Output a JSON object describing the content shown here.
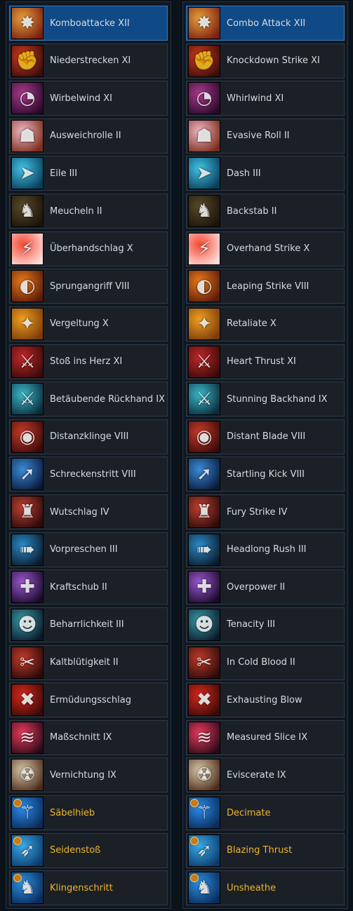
{
  "left_items": [
    {
      "label": "Komboattacke XII",
      "icon": "combo-attack-icon",
      "selected": true,
      "gold": false
    },
    {
      "label": "Niederstrecken XI",
      "icon": "knockdown-strike-icon",
      "selected": false,
      "gold": false
    },
    {
      "label": "Wirbelwind XI",
      "icon": "whirlwind-icon",
      "selected": false,
      "gold": false
    },
    {
      "label": "Ausweichrolle II",
      "icon": "evasive-roll-icon",
      "selected": false,
      "gold": false
    },
    {
      "label": "Eile III",
      "icon": "dash-icon",
      "selected": false,
      "gold": false
    },
    {
      "label": "Meucheln II",
      "icon": "backstab-icon",
      "selected": false,
      "gold": false
    },
    {
      "label": "Überhandschlag X",
      "icon": "overhand-strike-icon",
      "selected": false,
      "gold": false
    },
    {
      "label": "Sprungangriff VIII",
      "icon": "leaping-strike-icon",
      "selected": false,
      "gold": false
    },
    {
      "label": "Vergeltung X",
      "icon": "retaliate-icon",
      "selected": false,
      "gold": false
    },
    {
      "label": "Stoß ins Herz XI",
      "icon": "heart-thrust-icon",
      "selected": false,
      "gold": false
    },
    {
      "label": "Betäubende Rückhand IX",
      "icon": "stunning-backhand-icon",
      "selected": false,
      "gold": false
    },
    {
      "label": "Distanzklinge VIII",
      "icon": "distant-blade-icon",
      "selected": false,
      "gold": false
    },
    {
      "label": "Schreckenstritt VIII",
      "icon": "startling-kick-icon",
      "selected": false,
      "gold": false
    },
    {
      "label": "Wutschlag IV",
      "icon": "fury-strike-icon",
      "selected": false,
      "gold": false
    },
    {
      "label": "Vorpreschen III",
      "icon": "headlong-rush-icon",
      "selected": false,
      "gold": false
    },
    {
      "label": "Kraftschub II",
      "icon": "overpower-icon",
      "selected": false,
      "gold": false
    },
    {
      "label": "Beharrlichkeit III",
      "icon": "tenacity-icon",
      "selected": false,
      "gold": false
    },
    {
      "label": "Kaltblütigkeit II",
      "icon": "in-cold-blood-icon",
      "selected": false,
      "gold": false
    },
    {
      "label": "Ermüdungsschlag",
      "icon": "exhausting-blow-icon",
      "selected": false,
      "gold": false
    },
    {
      "label": "Maßschnitt IX",
      "icon": "measured-slice-icon",
      "selected": false,
      "gold": false
    },
    {
      "label": "Vernichtung IX",
      "icon": "eviscerate-icon",
      "selected": false,
      "gold": false
    },
    {
      "label": "Säbelhieb",
      "icon": "decimate-icon",
      "selected": false,
      "gold": true
    },
    {
      "label": "Seidenstoß",
      "icon": "blazing-thrust-icon",
      "selected": false,
      "gold": true
    },
    {
      "label": "Klingenschritt",
      "icon": "unsheathe-icon",
      "selected": false,
      "gold": true
    }
  ],
  "right_items": [
    {
      "label": "Combo Attack XII",
      "icon": "combo-attack-icon",
      "selected": true,
      "gold": false
    },
    {
      "label": "Knockdown Strike XI",
      "icon": "knockdown-strike-icon",
      "selected": false,
      "gold": false
    },
    {
      "label": "Whirlwind XI",
      "icon": "whirlwind-icon",
      "selected": false,
      "gold": false
    },
    {
      "label": "Evasive Roll II",
      "icon": "evasive-roll-icon",
      "selected": false,
      "gold": false
    },
    {
      "label": "Dash III",
      "icon": "dash-icon",
      "selected": false,
      "gold": false
    },
    {
      "label": "Backstab II",
      "icon": "backstab-icon",
      "selected": false,
      "gold": false
    },
    {
      "label": "Overhand Strike X",
      "icon": "overhand-strike-icon",
      "selected": false,
      "gold": false
    },
    {
      "label": "Leaping Strike VIII",
      "icon": "leaping-strike-icon",
      "selected": false,
      "gold": false
    },
    {
      "label": "Retaliate X",
      "icon": "retaliate-icon",
      "selected": false,
      "gold": false
    },
    {
      "label": "Heart Thrust XI",
      "icon": "heart-thrust-icon",
      "selected": false,
      "gold": false
    },
    {
      "label": "Stunning Backhand IX",
      "icon": "stunning-backhand-icon",
      "selected": false,
      "gold": false
    },
    {
      "label": "Distant Blade VIII",
      "icon": "distant-blade-icon",
      "selected": false,
      "gold": false
    },
    {
      "label": "Startling Kick VIII",
      "icon": "startling-kick-icon",
      "selected": false,
      "gold": false
    },
    {
      "label": "Fury Strike IV",
      "icon": "fury-strike-icon",
      "selected": false,
      "gold": false
    },
    {
      "label": "Headlong Rush III",
      "icon": "headlong-rush-icon",
      "selected": false,
      "gold": false
    },
    {
      "label": "Overpower II",
      "icon": "overpower-icon",
      "selected": false,
      "gold": false
    },
    {
      "label": "Tenacity III",
      "icon": "tenacity-icon",
      "selected": false,
      "gold": false
    },
    {
      "label": "In Cold Blood II",
      "icon": "in-cold-blood-icon",
      "selected": false,
      "gold": false
    },
    {
      "label": "Exhausting Blow",
      "icon": "exhausting-blow-icon",
      "selected": false,
      "gold": false
    },
    {
      "label": "Measured Slice IX",
      "icon": "measured-slice-icon",
      "selected": false,
      "gold": false
    },
    {
      "label": "Eviscerate IX",
      "icon": "eviscerate-icon",
      "selected": false,
      "gold": false
    },
    {
      "label": "Decimate",
      "icon": "decimate-icon",
      "selected": false,
      "gold": true
    },
    {
      "label": "Blazing Thrust",
      "icon": "blazing-thrust-icon",
      "selected": false,
      "gold": true
    },
    {
      "label": "Unsheathe",
      "icon": "unsheathe-icon",
      "selected": false,
      "gold": true
    }
  ],
  "icon_colors": {
    "combo-attack-icon": [
      "#e8a23a",
      "#7a1e12"
    ],
    "knockdown-strike-icon": [
      "#d13a1f",
      "#3a0d0a"
    ],
    "whirlwind-icon": [
      "#a83a8c",
      "#2a0a2a"
    ],
    "evasive-roll-icon": [
      "#f0b9c8",
      "#7a2c1a"
    ],
    "dash-icon": [
      "#41c4e6",
      "#0a3c5a"
    ],
    "backstab-icon": [
      "#5a4a2a",
      "#1a120a"
    ],
    "overhand-strike-icon": [
      "#f24b34",
      "#fdd"
    ],
    "leaping-strike-icon": [
      "#e87a1a",
      "#5a1a0a"
    ],
    "retaliate-icon": [
      "#f0a020",
      "#7a3a0a"
    ],
    "heart-thrust-icon": [
      "#c0282a",
      "#3a0a0a"
    ],
    "stunning-backhand-icon": [
      "#3ab8c8",
      "#0a2a3a"
    ],
    "distant-blade-icon": [
      "#c83a2a",
      "#3a0a0a"
    ],
    "startling-kick-icon": [
      "#3a8ad8",
      "#0a1a3a"
    ],
    "fury-strike-icon": [
      "#c04030",
      "#2a0a0a"
    ],
    "headlong-rush-icon": [
      "#2a8ac8",
      "#0a1a2a"
    ],
    "overpower-icon": [
      "#9a58d0",
      "#1a0a2a"
    ],
    "tenacity-icon": [
      "#3a9aa8",
      "#0a1a2a"
    ],
    "in-cold-blood-icon": [
      "#c03a2a",
      "#2a0a0a"
    ],
    "exhausting-blow-icon": [
      "#d8281a",
      "#3a0a0a"
    ],
    "measured-slice-icon": [
      "#e83a5a",
      "#2a0a1a"
    ],
    "eviscerate-icon": [
      "#d8c8a8",
      "#4a2a1a"
    ],
    "decimate-icon": [
      "#2a8ae8",
      "#0a2a5a"
    ],
    "blazing-thrust-icon": [
      "#3aa8e8",
      "#0a3a6a"
    ],
    "unsheathe-icon": [
      "#2a90e0",
      "#0a2a5a"
    ]
  },
  "icon_glyphs": {
    "combo-attack-icon": "✸",
    "knockdown-strike-icon": "✊",
    "whirlwind-icon": "◔",
    "evasive-roll-icon": "☗",
    "dash-icon": "➤",
    "backstab-icon": "♞",
    "overhand-strike-icon": "⚡",
    "leaping-strike-icon": "◐",
    "retaliate-icon": "✦",
    "heart-thrust-icon": "⚔",
    "stunning-backhand-icon": "⚔",
    "distant-blade-icon": "◉",
    "startling-kick-icon": "➚",
    "fury-strike-icon": "♜",
    "headlong-rush-icon": "➠",
    "overpower-icon": "✚",
    "tenacity-icon": "☻",
    "in-cold-blood-icon": "✂",
    "exhausting-blow-icon": "✖",
    "measured-slice-icon": "≋",
    "eviscerate-icon": "☢",
    "decimate-icon": "⚚",
    "blazing-thrust-icon": "➶",
    "unsheathe-icon": "♞"
  },
  "colors": {
    "selected_row": "#0f4a86",
    "row": "#1b2027",
    "text": "#d7dbe0",
    "gold_text": "#f0b52a"
  }
}
